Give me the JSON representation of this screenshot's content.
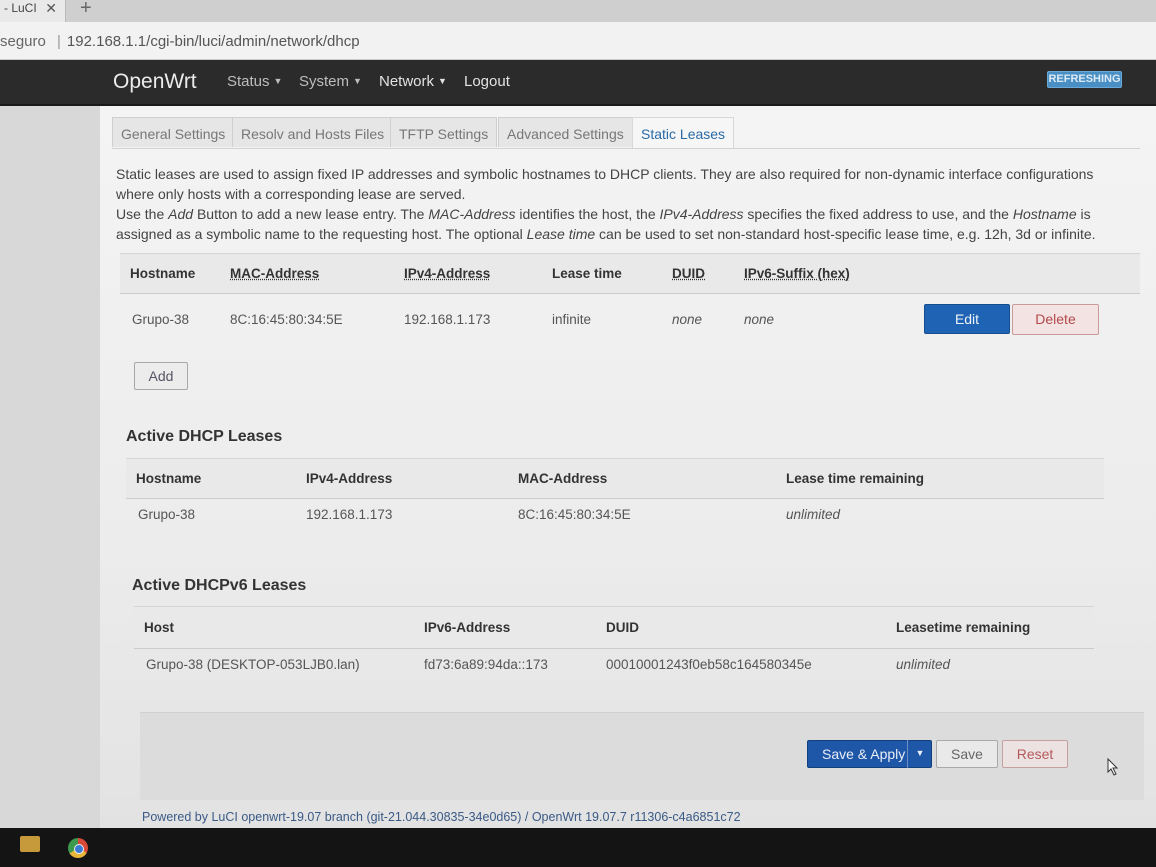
{
  "browser": {
    "tab_title": "- LuCI",
    "close_glyph": "✕",
    "new_tab_glyph": "+",
    "security_label": "seguro",
    "address_separator": "|",
    "url": "192.168.1.1/cgi-bin/luci/admin/network/dhcp"
  },
  "header": {
    "brand": "OpenWrt",
    "menu": [
      "Status",
      "System",
      "Network",
      "Logout"
    ],
    "status_badge": "REFRESHING"
  },
  "tabs": [
    "General Settings",
    "Resolv and Hosts Files",
    "TFTP Settings",
    "Advanced Settings",
    "Static Leases"
  ],
  "active_tab": "Static Leases",
  "description": {
    "line1": "Static leases are used to assign fixed IP addresses and symbolic hostnames to DHCP clients. They are also required for non-dynamic interface configurations where only hosts with a corresponding lease are served.",
    "p2_a": "Use the ",
    "p2_add": "Add",
    "p2_b": " Button to add a new lease entry. The ",
    "p2_mac": "MAC-Address",
    "p2_c": " identifies the host, the ",
    "p2_ipv4": "IPv4-Address",
    "p2_d": " specifies the fixed address to use, and the ",
    "p2_host": "Hostname",
    "p2_e": " is assigned as a symbolic name to the requesting host. The optional ",
    "p2_lease": "Lease time",
    "p2_f": " can be used to set non-standard host-specific lease time, e.g. 12h, 3d or infinite."
  },
  "static_leases": {
    "headers": [
      "Hostname",
      "MAC-Address",
      "IPv4-Address",
      "Lease time",
      "DUID",
      "IPv6-Suffix (hex)"
    ],
    "rows": [
      {
        "hostname": "Grupo-38",
        "mac": "8C:16:45:80:34:5E",
        "ipv4": "192.168.1.173",
        "lease_time": "infinite",
        "duid": "none",
        "ipv6_suffix": "none"
      }
    ],
    "edit_label": "Edit",
    "delete_label": "Delete",
    "add_label": "Add"
  },
  "active_dhcp": {
    "title": "Active DHCP Leases",
    "headers": [
      "Hostname",
      "IPv4-Address",
      "MAC-Address",
      "Lease time remaining"
    ],
    "rows": [
      {
        "hostname": "Grupo-38",
        "ipv4": "192.168.1.173",
        "mac": "8C:16:45:80:34:5E",
        "remaining": "unlimited"
      }
    ]
  },
  "active_dhcpv6": {
    "title": "Active DHCPv6 Leases",
    "headers": [
      "Host",
      "IPv6-Address",
      "DUID",
      "Leasetime remaining"
    ],
    "rows": [
      {
        "host": "Grupo-38 (DESKTOP-053LJB0.lan)",
        "ipv6": "fd73:6a89:94da::173",
        "duid": "00010001243f0eb58c164580345e",
        "remaining": "unlimited"
      }
    ]
  },
  "actions": {
    "save_apply": "Save & Apply",
    "save": "Save",
    "reset": "Reset"
  },
  "footer": "Powered by LuCI openwrt-19.07 branch (git-21.044.30835-34e0d65) / OpenWrt 19.07.7 r11306-c4a6851c72",
  "colors": {
    "navbar": "#2b2b2b",
    "primary_button": "#1e63b4",
    "danger_text": "#b24a4a",
    "active_tab_text": "#2a6aa7"
  }
}
